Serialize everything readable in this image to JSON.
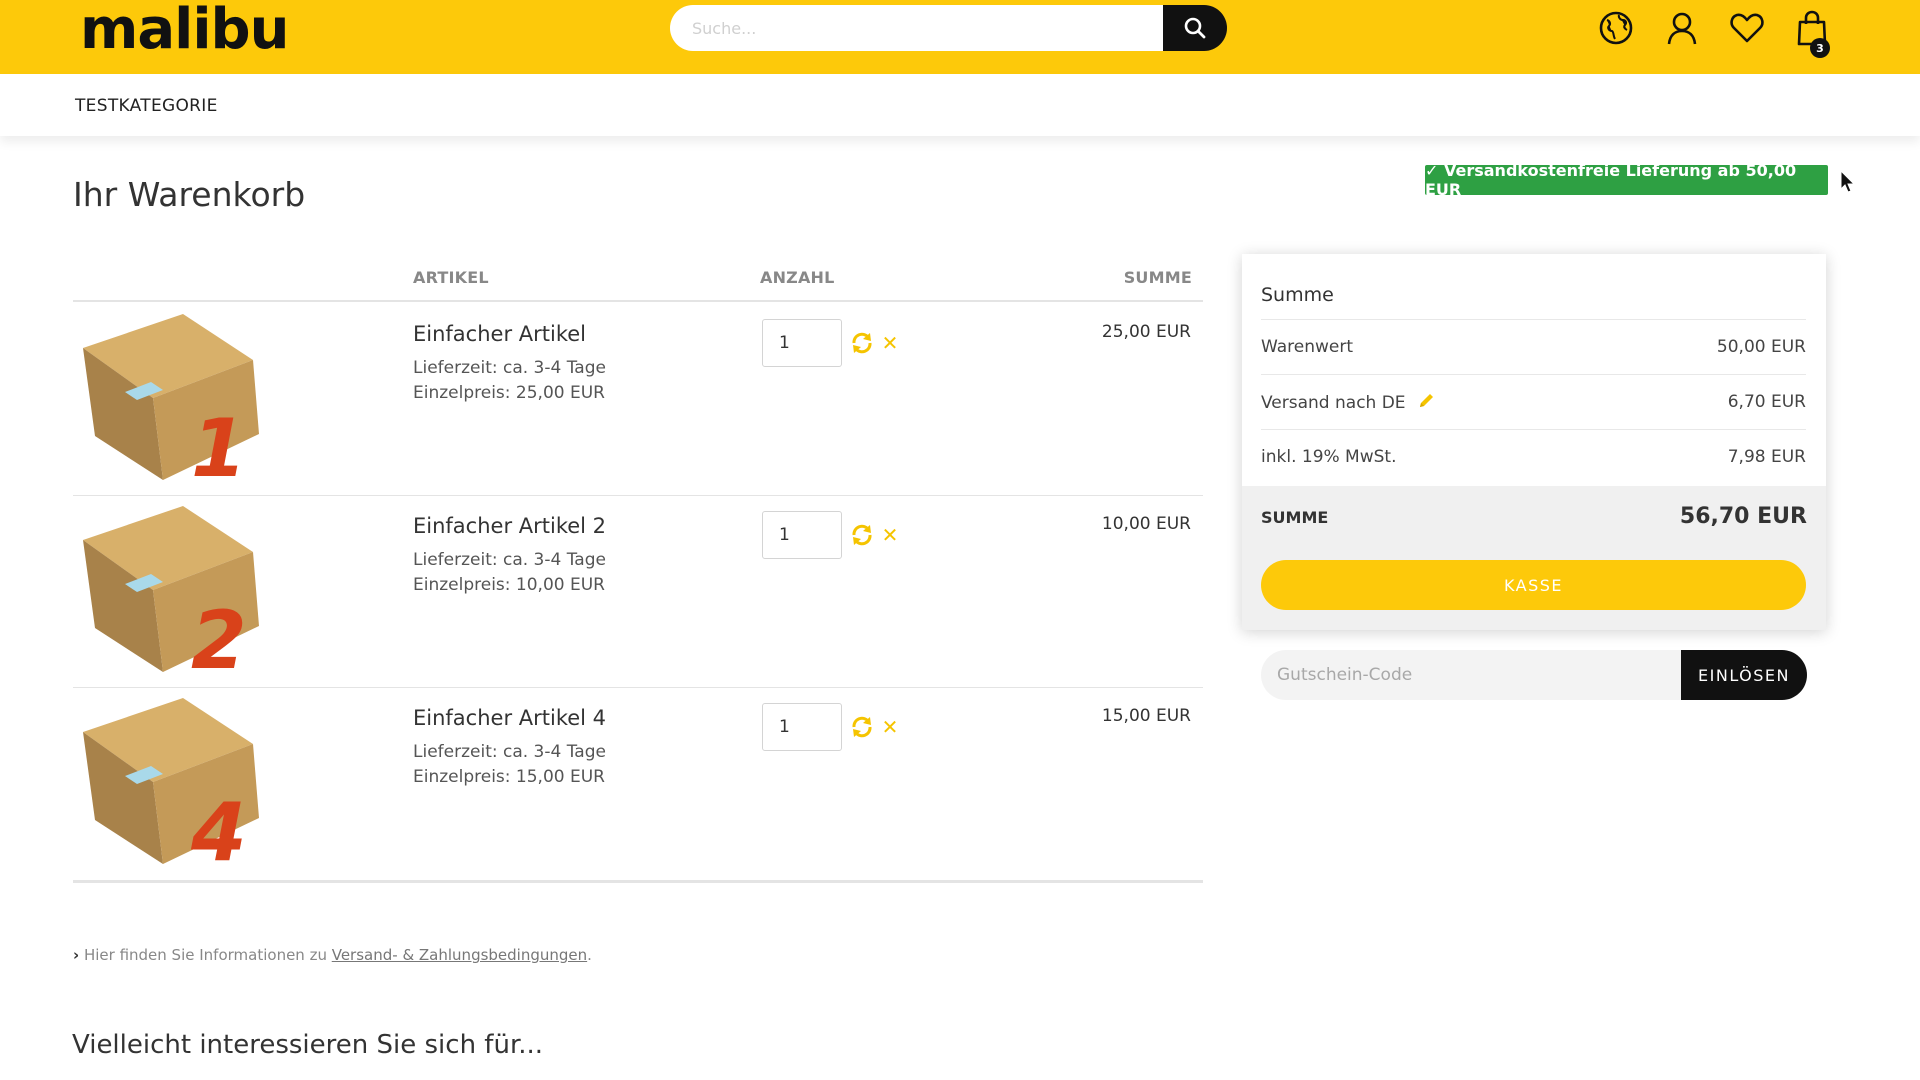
{
  "header": {
    "logo": "malibu",
    "search_placeholder": "Suche...",
    "cart_count": "3",
    "icons": [
      "search-icon",
      "globe-icon",
      "user-icon",
      "heart-icon",
      "shopping-bag-icon"
    ]
  },
  "nav": {
    "items": [
      "TESTKATEGORIE"
    ]
  },
  "page": {
    "title": "Ihr Warenkorb",
    "shipping_badge": "✓ Versandkostenfreie Lieferung ab 50,00 EUR"
  },
  "cart": {
    "headers": {
      "article": "ARTIKEL",
      "quantity": "ANZAHL",
      "sum": "SUMME"
    },
    "items": [
      {
        "number": "1",
        "name": "Einfacher Artikel",
        "delivery": "Lieferzeit: ca. 3-4 Tage",
        "unit_price": "Einzelpreis: 25,00 EUR",
        "quantity": "1",
        "sum": "25,00 EUR"
      },
      {
        "number": "2",
        "name": "Einfacher Artikel 2",
        "delivery": "Lieferzeit: ca. 3-4 Tage",
        "unit_price": "Einzelpreis: 10,00 EUR",
        "quantity": "1",
        "sum": "10,00 EUR"
      },
      {
        "number": "4",
        "name": "Einfacher Artikel 4",
        "delivery": "Lieferzeit: ca. 3-4 Tage",
        "unit_price": "Einzelpreis: 15,00 EUR",
        "quantity": "1",
        "sum": "15,00 EUR"
      }
    ],
    "info_prefix": "Hier finden Sie Informationen zu ",
    "info_link": "Versand- & Zahlungsbedingungen",
    "info_suffix": "."
  },
  "summary": {
    "title": "Summe",
    "rows": [
      {
        "label": "Warenwert",
        "value": "50,00 EUR"
      },
      {
        "label": "Versand nach DE",
        "value": "6,70 EUR"
      },
      {
        "label": "inkl. 19% MwSt.",
        "value": "7,98 EUR"
      }
    ],
    "total_label": "SUMME",
    "total_value": "56,70 EUR",
    "checkout_label": "KASSE"
  },
  "voucher": {
    "placeholder": "Gutschein-Code",
    "button_label": "EINLÖSEN"
  },
  "related": {
    "title": "Vielleicht interessieren Sie sich für..."
  },
  "colors": {
    "brand_yellow": "#fdc90a",
    "badge_green": "#2ea043",
    "dark": "#111111",
    "box_digit": "#d9421a"
  }
}
